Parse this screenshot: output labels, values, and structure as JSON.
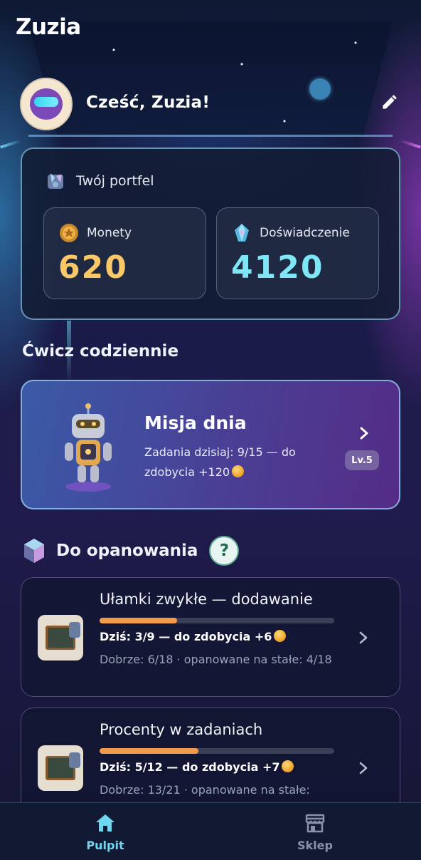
{
  "app": {
    "title": "Zuzia"
  },
  "greeting": {
    "text": "Cześć, Zuzia!",
    "avatar_icon": "robot-avatar-icon",
    "edit_icon": "pencil-icon"
  },
  "wallet": {
    "title": "Twój portfel",
    "icon": "wallet-crystal-icon",
    "coins": {
      "label": "Monety",
      "value": "620",
      "icon": "coin-icon",
      "color": "#fbc868"
    },
    "experience": {
      "label": "Doświadczenie",
      "value": "4120",
      "icon": "crystal-icon",
      "color": "#7fe6f5"
    }
  },
  "daily": {
    "section_title": "Ćwicz codziennie",
    "mission": {
      "title": "Misja dnia",
      "description": "Zadania dzisiaj: 9/15 — do zdobycia +120",
      "level_badge": "Lv.5",
      "icon": "robot-icon"
    }
  },
  "mastery": {
    "section_title": "Do opanowania",
    "help_label": "?",
    "topics": [
      {
        "title": "Ułamki zwykłe — dodawanie",
        "progress": 0.33,
        "today": "Dziś: 3/9 — do zdobycia +6",
        "stats": "Dobrze: 6/18 · opanowane na stałe: 4/18"
      },
      {
        "title": "Procenty w zadaniach",
        "progress": 0.42,
        "today": "Dziś: 5/12 — do zdobycia +7",
        "stats": "Dobrze: 13/21 · opanowane na stałe:"
      }
    ]
  },
  "nav": {
    "dashboard": {
      "label": "Pulpit",
      "icon": "home-icon",
      "active": true
    },
    "shop": {
      "label": "Sklep",
      "icon": "store-icon",
      "active": false
    }
  },
  "colors": {
    "accent": "#6fd6f0",
    "progress": "#f09a4a",
    "coin": "#fbc868"
  }
}
